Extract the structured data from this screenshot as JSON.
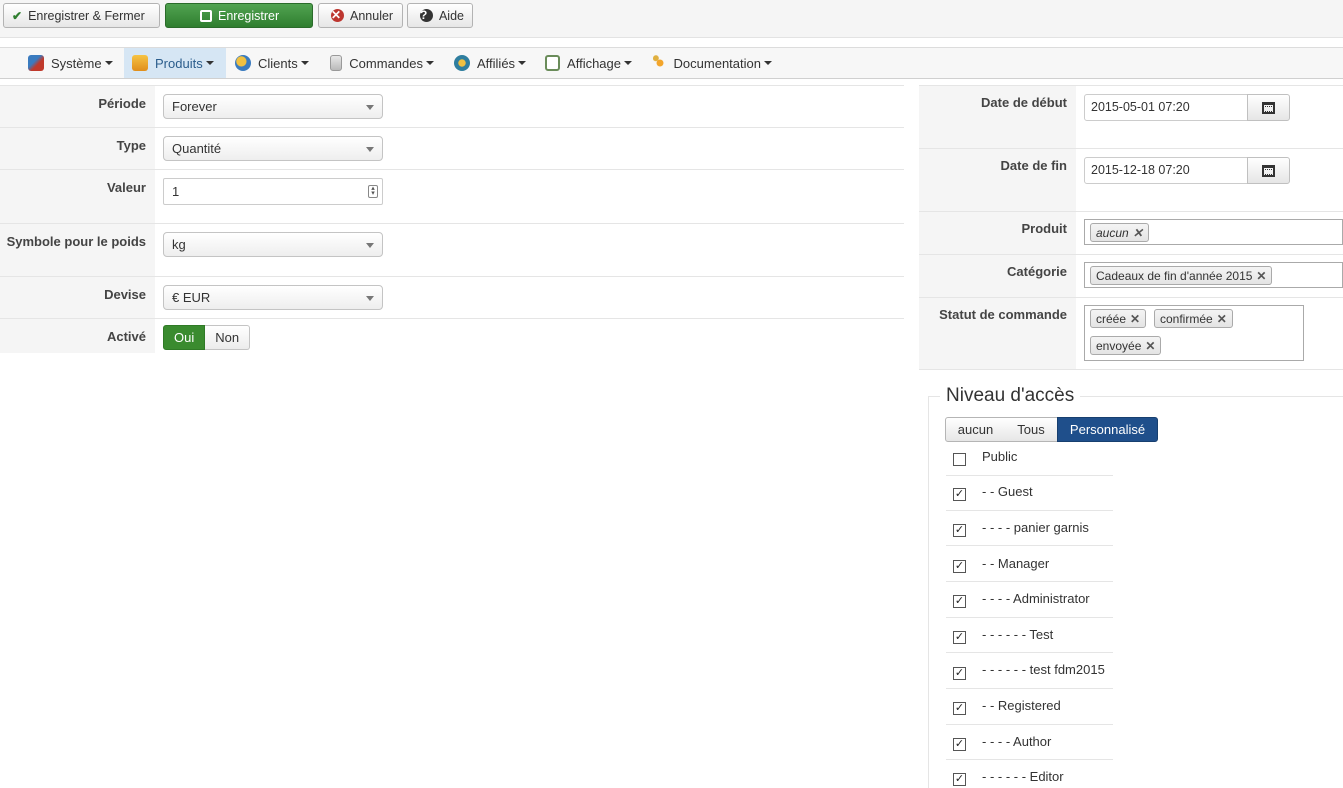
{
  "toolbar": {
    "save_close": "Enregistrer & Fermer",
    "save": "Enregistrer",
    "cancel": "Annuler",
    "help": "Aide"
  },
  "menu": [
    {
      "label": "Système",
      "icon": "tools-icon",
      "active": false
    },
    {
      "label": "Produits",
      "icon": "products-icon",
      "active": true
    },
    {
      "label": "Clients",
      "icon": "customers-icon",
      "active": false
    },
    {
      "label": "Commandes",
      "icon": "orders-icon",
      "active": false
    },
    {
      "label": "Affiliés",
      "icon": "affiliates-icon",
      "active": false
    },
    {
      "label": "Affichage",
      "icon": "display-icon",
      "active": false
    },
    {
      "label": "Documentation",
      "icon": "documentation-icon",
      "active": false
    }
  ],
  "left_form": {
    "period_label": "Période",
    "period_value": "Forever",
    "type_label": "Type",
    "type_value": "Quantité",
    "value_label": "Valeur",
    "value_value": "1",
    "weight_label": "Symbole pour le poids",
    "weight_value": "kg",
    "currency_label": "Devise",
    "currency_value": "€ EUR",
    "active_label": "Activé",
    "active_yes": "Oui",
    "active_no": "Non",
    "active_selected": "Oui"
  },
  "right_form": {
    "start_label": "Date de début",
    "start_value": "2015-05-01 07:20",
    "end_label": "Date de fin",
    "end_value": "2015-12-18 07:20",
    "product_label": "Produit",
    "product_tags": [
      "aucun"
    ],
    "category_label": "Catégorie",
    "category_tags": [
      "Cadeaux de fin d'année 2015"
    ],
    "status_label": "Statut de commande",
    "status_tags": [
      "créée",
      "confirmée",
      "envoyée"
    ]
  },
  "access": {
    "legend": "Niveau d'accès",
    "modes": [
      "aucun",
      "Tous",
      "Personnalisé"
    ],
    "selected_mode": "Personnalisé",
    "items": [
      {
        "label": "Public",
        "checked": false
      },
      {
        "label": "- - Guest",
        "checked": true
      },
      {
        "label": "- - - - panier garnis",
        "checked": true
      },
      {
        "label": "- - Manager",
        "checked": true
      },
      {
        "label": "- - - - Administrator",
        "checked": true
      },
      {
        "label": "- - - - - - Test",
        "checked": true
      },
      {
        "label": "- - - - - - test fdm2015",
        "checked": true
      },
      {
        "label": "- - Registered",
        "checked": true
      },
      {
        "label": "- - - - Author",
        "checked": true
      },
      {
        "label": "- - - - - - Editor",
        "checked": true
      }
    ]
  },
  "colors": {
    "primary_green": "#3a8b2f",
    "selected_blue": "#1f4f8b",
    "menu_active_bg": "#d6e6f4"
  }
}
